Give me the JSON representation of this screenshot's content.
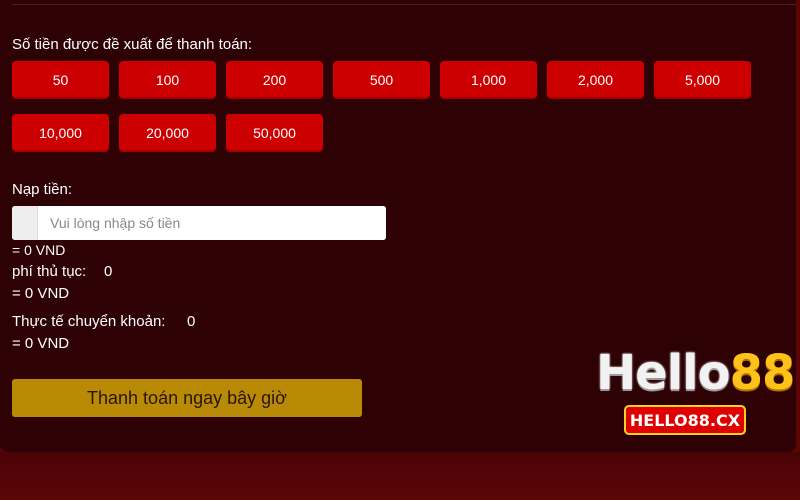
{
  "deposit_form": {
    "suggested_label": "Số tiền được đề xuất để thanh toán:",
    "amounts": [
      "50",
      "100",
      "200",
      "500",
      "1,000",
      "2,000",
      "5,000",
      "10,000",
      "20,000",
      "50,000"
    ],
    "deposit_label": "Nạp tiền:",
    "amount_input": {
      "value": "",
      "placeholder": "Vui lòng nhập số tiền"
    },
    "deposit_converted": "= 0 VND",
    "fee_label": "phí thủ tục:",
    "fee_value": "0",
    "fee_converted": "= 0 VND",
    "actual_label": "Thực tế chuyển khoản:",
    "actual_value": "0",
    "actual_converted": "= 0 VND",
    "pay_button_label": "Thanh toán ngay bây giờ"
  },
  "watermark": {
    "brand_text_main": "Hello",
    "brand_text_num": "88",
    "badge_text": "HELLO88.CX"
  },
  "colors": {
    "panel_bg": "#2e0204",
    "amount_button": "#cc0000",
    "pay_button": "#b88a06",
    "page_bg": "#5a0404"
  }
}
